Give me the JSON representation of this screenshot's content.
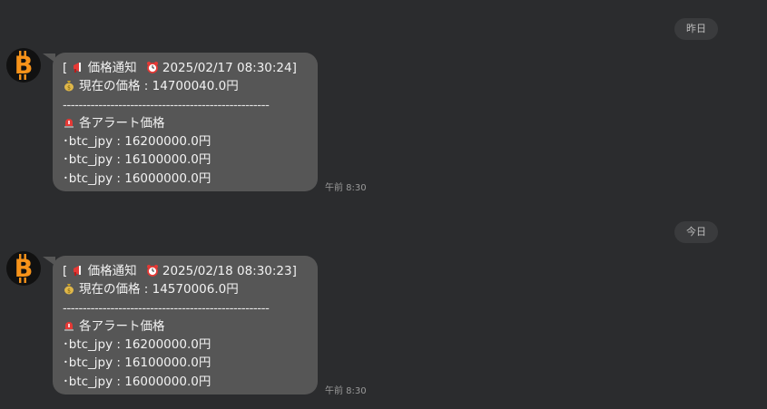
{
  "dates": {
    "yesterday": "昨日",
    "today": "今日"
  },
  "messages": [
    {
      "header_prefix": "[",
      "header_title": "価格通知",
      "header_datetime": "2025/02/17 08:30:24]",
      "current_price": "現在の価格 : 14700040.0円",
      "divider": "----------------------------------------------------",
      "alerts_title": "各アラート価格",
      "alerts": [
        "･btc_jpy : 16200000.0円",
        "･btc_jpy : 16100000.0円",
        "･btc_jpy : 16000000.0円"
      ],
      "time": "午前 8:30"
    },
    {
      "header_prefix": "[",
      "header_title": "価格通知",
      "header_datetime": "2025/02/18 08:30:23]",
      "current_price": "現在の価格 : 14570006.0円",
      "divider": "----------------------------------------------------",
      "alerts_title": "各アラート価格",
      "alerts": [
        "･btc_jpy : 16200000.0円",
        "･btc_jpy : 16100000.0円",
        "･btc_jpy : 16000000.0円"
      ],
      "time": "午前 8:30"
    }
  ],
  "icons": {
    "avatar": "bitcoin-icon",
    "megaphone": "megaphone-icon",
    "alarm": "alarm-clock-icon",
    "money": "money-bag-icon",
    "siren": "siren-icon"
  },
  "colors": {
    "background": "#2b2c2e",
    "bubble": "#565656",
    "badge": "#3a3b3d",
    "bitcoin_orange": "#f7931a"
  }
}
